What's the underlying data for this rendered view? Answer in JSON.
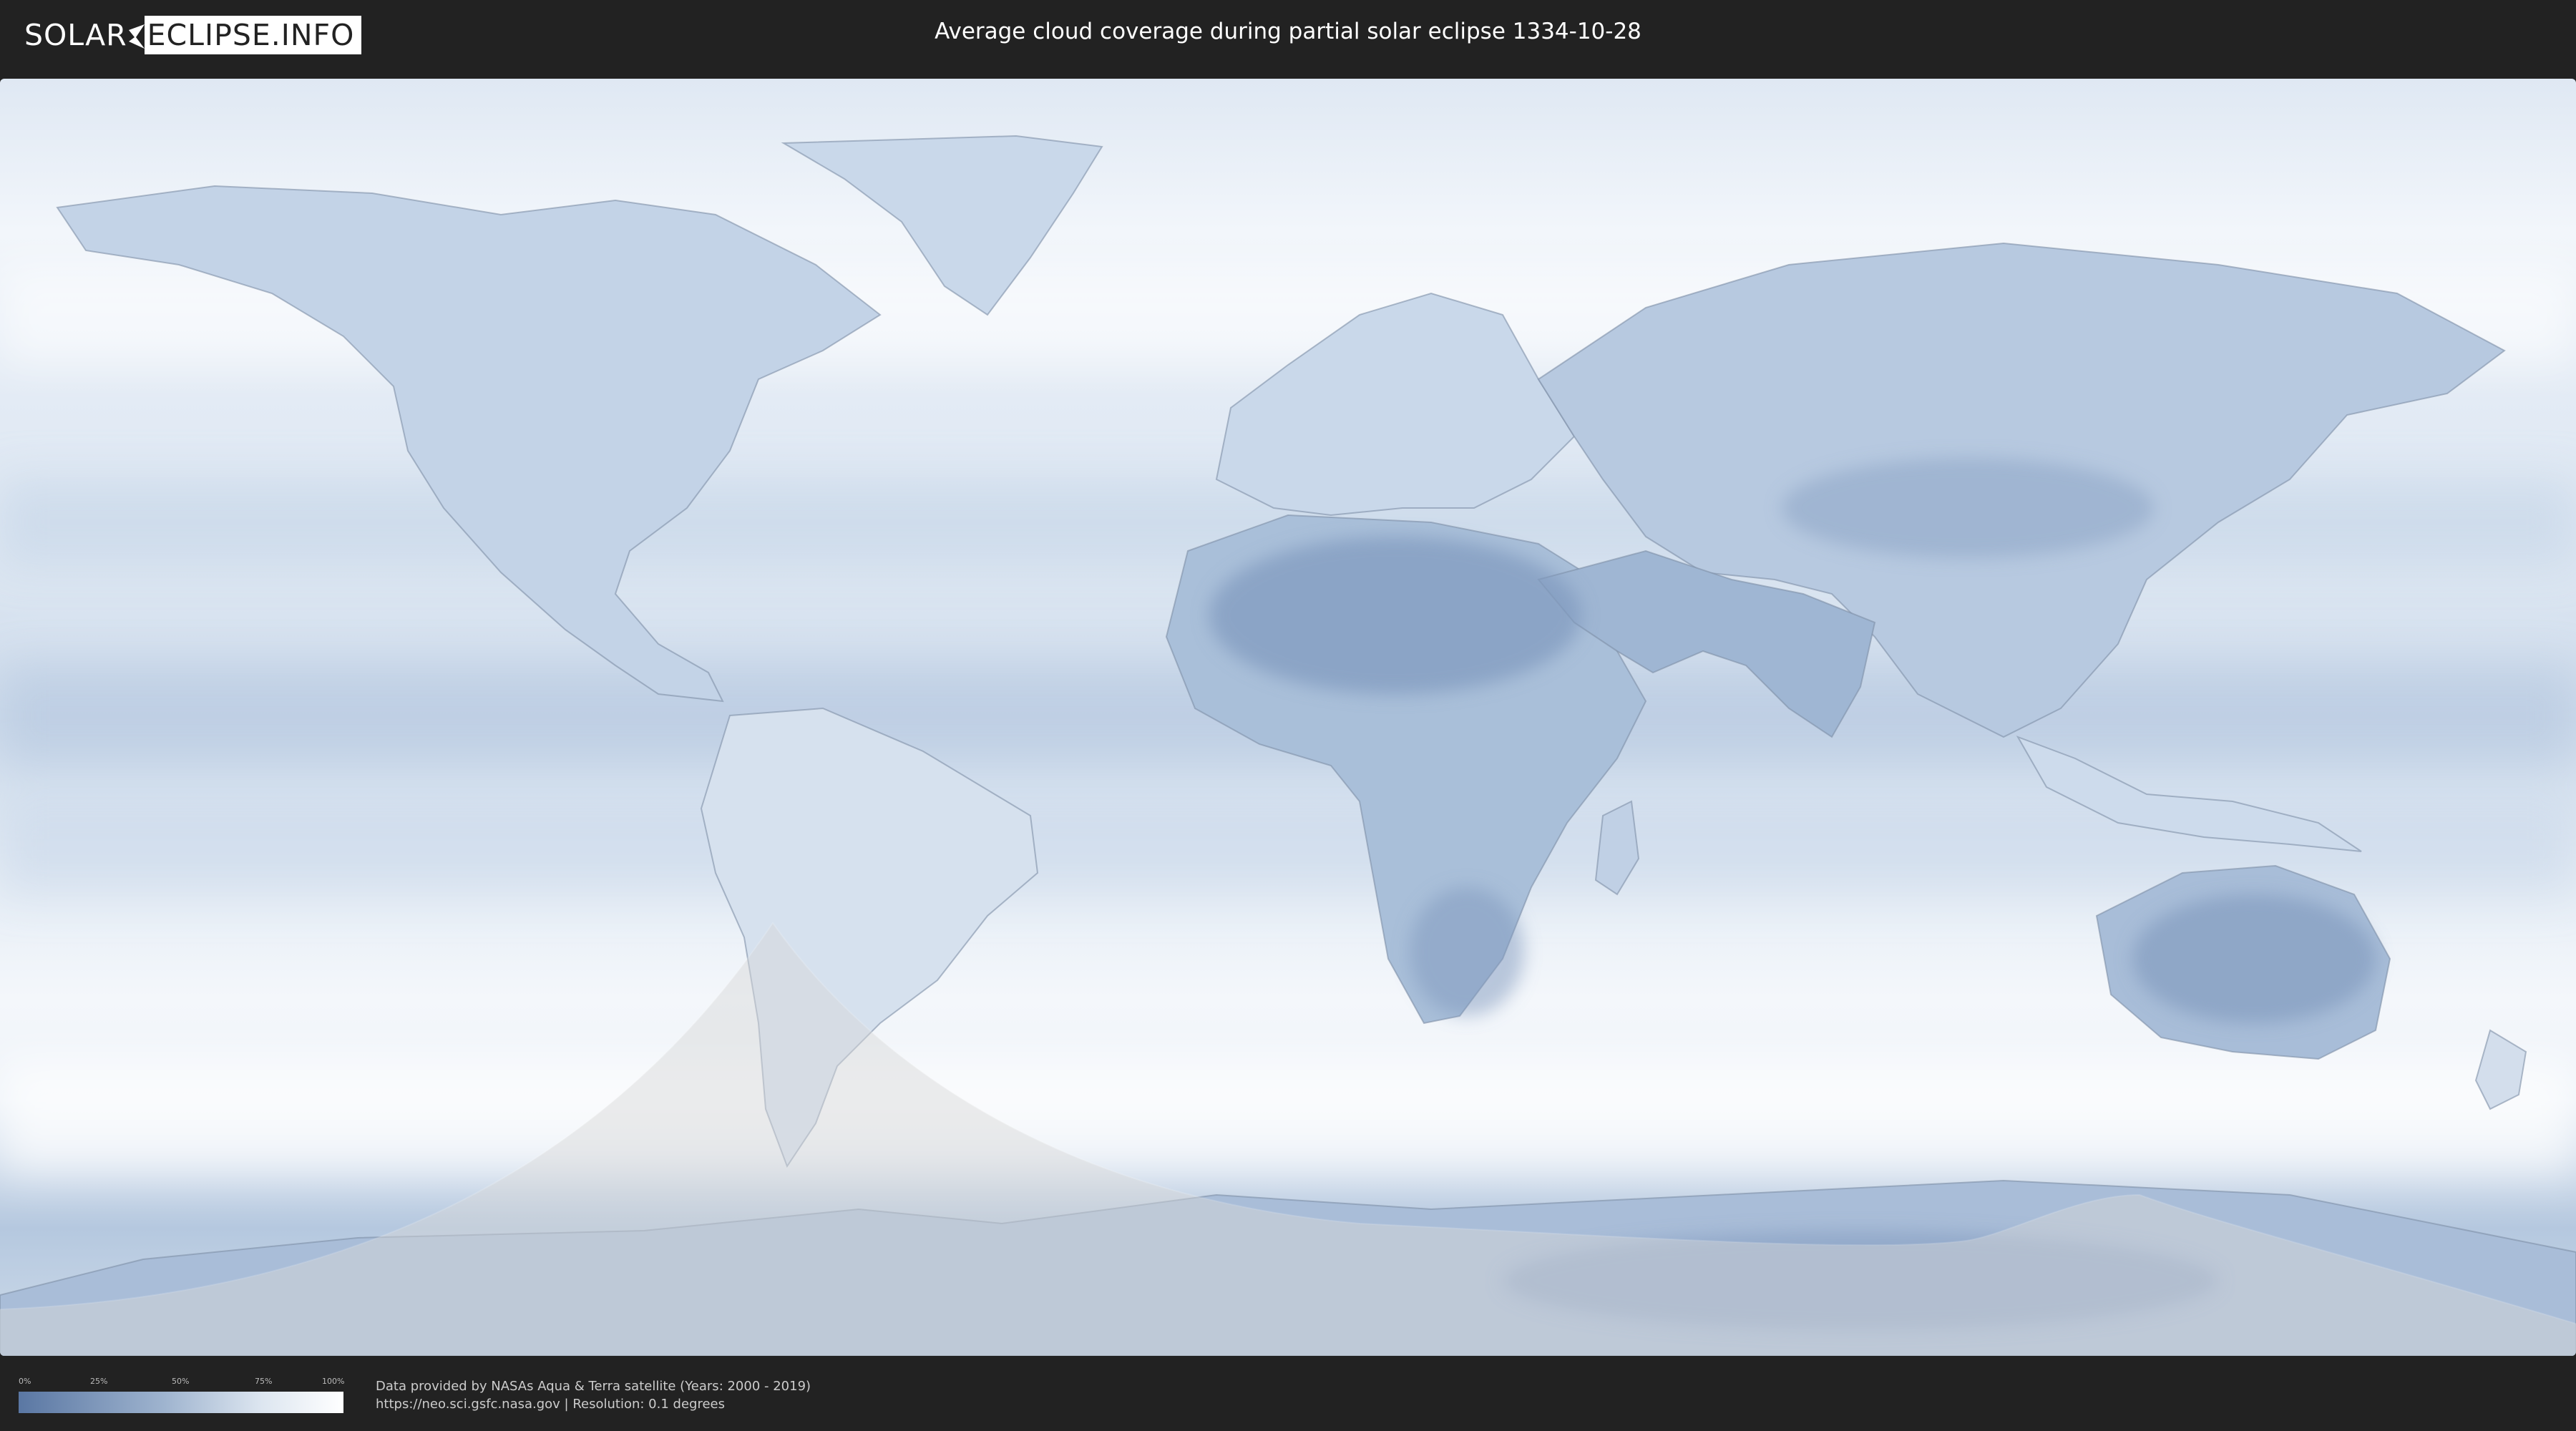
{
  "header": {
    "logo_left": "SOLAR",
    "logo_right": "ECLIPSE.INFO",
    "title": "Average cloud coverage during partial solar eclipse 1334-10-28"
  },
  "map": {
    "type": "cloud-coverage-world-map",
    "colors": {
      "clear": "#5a77a3",
      "cloudy": "#ffffff",
      "eclipse_overlay": "#d8d8d8",
      "background": "#222222"
    }
  },
  "legend": {
    "ticks": [
      "0%",
      "25%",
      "50%",
      "75%",
      "100%"
    ],
    "gradient_from": "#5a77a3",
    "gradient_to": "#ffffff"
  },
  "footer": {
    "credit_line1": "Data provided by NASAs Aqua & Terra satellite (Years: 2000 - 2019)",
    "credit_line2": "https://neo.sci.gsfc.nasa.gov | Resolution: 0.1 degrees"
  }
}
